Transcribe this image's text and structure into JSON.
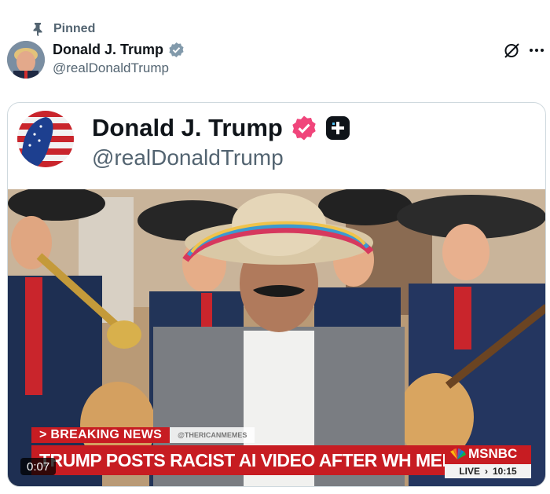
{
  "post": {
    "pinned_label": "Pinned",
    "author": {
      "name": "Donald J. Trump",
      "handle": "@realDonaldTrump",
      "verified": true,
      "badge_color": "#1d9bf0"
    },
    "actions": {
      "grok_icon": "grok-icon",
      "more_icon": "more-dots-icon"
    }
  },
  "embedded_card": {
    "author_name": "Donald J. Trump",
    "author_handle": "@realDonaldTrump",
    "badge_color": "#f0457b",
    "extra_icon": "plus-square-icon"
  },
  "video": {
    "duration": "0:07",
    "chyron": {
      "breaking_label": "> BREAKING NEWS",
      "source_tag": "@THERICANMEMES",
      "headline": "TRUMP POSTS RACIST AI VIDEO AFTER WH MEETING W/ DEMS",
      "network": "MSNBC",
      "live_label": "LIVE",
      "time": "10:15"
    },
    "accent_color": "#c71c22"
  }
}
